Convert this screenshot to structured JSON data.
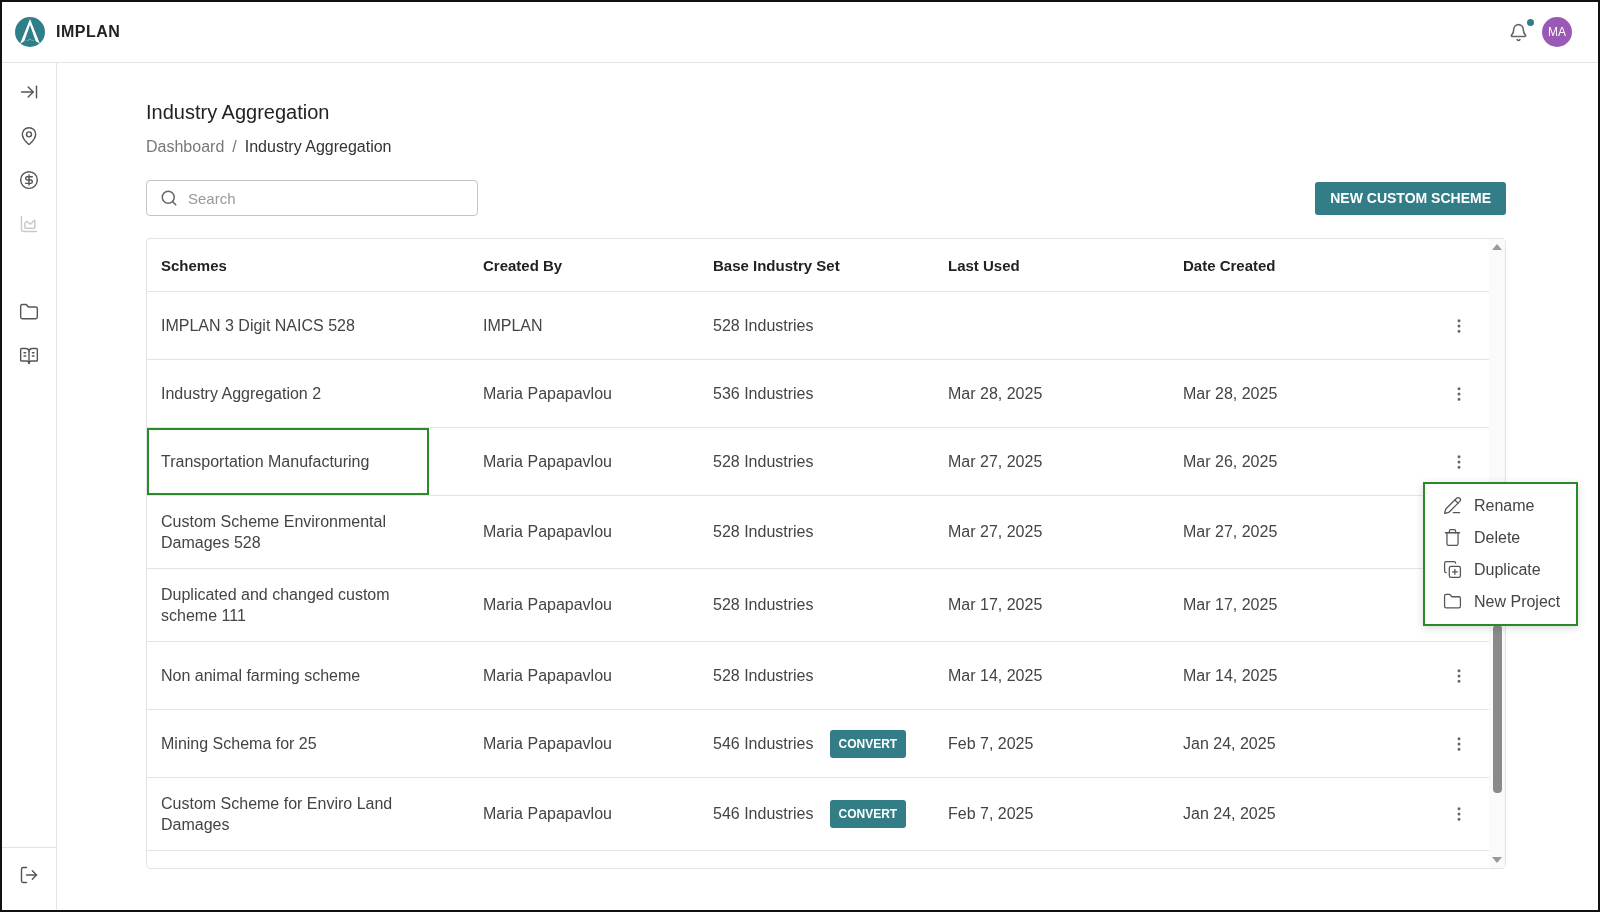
{
  "app": {
    "name": "IMPLAN"
  },
  "header": {
    "notification": true,
    "avatar": "MA"
  },
  "sidebar": {
    "items": [
      {
        "kind": "expand",
        "disabled": false
      },
      {
        "kind": "location",
        "disabled": false
      },
      {
        "kind": "dollar",
        "disabled": false
      },
      {
        "kind": "chart",
        "disabled": true
      }
    ],
    "lower_items": [
      {
        "kind": "folder",
        "disabled": false
      },
      {
        "kind": "book",
        "disabled": false
      }
    ],
    "footer": {
      "kind": "logout"
    }
  },
  "page": {
    "title": "Industry Aggregation",
    "breadcrumb": [
      {
        "label": "Dashboard",
        "current": false
      },
      {
        "label": "Industry Aggregation",
        "current": true
      }
    ],
    "separator": "/"
  },
  "search": {
    "placeholder": "Search"
  },
  "new_button": "NEW CUSTOM SCHEME",
  "table": {
    "columns": [
      "Schemes",
      "Created By",
      "Base Industry Set",
      "Last Used",
      "Date Created"
    ],
    "rows": [
      {
        "scheme": "IMPLAN 3 Digit NAICS 528",
        "created_by": "IMPLAN",
        "base_set": "528 Industries",
        "highlighted": false
      },
      {
        "scheme": "Industry Aggregation 2",
        "created_by": "Maria Papapavlou",
        "base_set": "536 Industries",
        "last_used": "Mar 28, 2025",
        "date_created": "Mar 28, 2025",
        "highlighted": false
      },
      {
        "scheme": "Transportation Manufacturing",
        "created_by": "Maria Papapavlou",
        "base_set": "528 Industries",
        "last_used": "Mar 27, 2025",
        "date_created": "Mar 26, 2025",
        "highlighted": true
      },
      {
        "scheme": "Custom Scheme Environmental Damages 528",
        "created_by": "Maria Papapavlou",
        "base_set": "528 Industries",
        "last_used": "Mar 27, 2025",
        "date_created": "Mar 27, 2025",
        "highlighted": false
      },
      {
        "scheme": "Duplicated and changed custom scheme 111",
        "created_by": "Maria Papapavlou",
        "base_set": "528 Industries",
        "last_used": "Mar 17, 2025",
        "date_created": "Mar 17, 2025",
        "highlighted": false
      },
      {
        "scheme": "Non animal farming scheme",
        "created_by": "Maria Papapavlou",
        "base_set": "528 Industries",
        "last_used": "Mar 14, 2025",
        "date_created": "Mar 14, 2025",
        "highlighted": false
      },
      {
        "scheme": "Mining Schema for 25",
        "created_by": "Maria Papapavlou",
        "base_set": "546 Industries",
        "convert": "CONVERT",
        "last_used": "Feb 7, 2025",
        "date_created": "Jan 24, 2025",
        "highlighted": false
      },
      {
        "scheme": "Custom Scheme for Enviro Land Damages",
        "created_by": "Maria Papapavlou",
        "base_set": "546 Industries",
        "convert": "CONVERT",
        "last_used": "Feb 7, 2025",
        "date_created": "Jan 24, 2025",
        "highlighted": false
      }
    ]
  },
  "menu": {
    "highlighted": true,
    "items": [
      {
        "kind": "rename",
        "label": "Rename"
      },
      {
        "kind": "delete",
        "label": "Delete"
      },
      {
        "kind": "duplicate",
        "label": "Duplicate"
      },
      {
        "kind": "folder",
        "label": "New Project"
      }
    ]
  }
}
